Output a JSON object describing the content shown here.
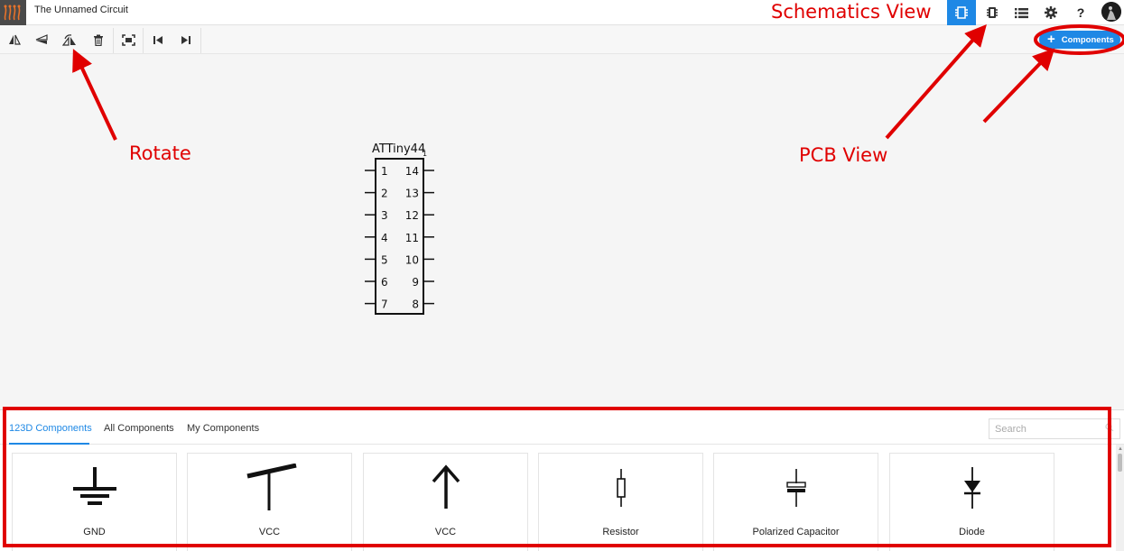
{
  "app": {
    "title": "The Unnamed Circuit"
  },
  "top_nav": {
    "schematic_view_icon": "schematic-chip-icon",
    "pcb_view_icon": "pcb-chip-icon",
    "list_icon": "list-icon",
    "settings_icon": "gear-icon",
    "help_label": "?"
  },
  "toolbar": {
    "tools": [
      "flip-horizontal-icon",
      "flip-vertical-icon",
      "rotate-icon",
      "trash-icon",
      "fit-to-screen-icon",
      "skip-back-icon",
      "skip-forward-icon"
    ],
    "components_button_label": "Components"
  },
  "schematic": {
    "part_name": "ATTiny44",
    "part_index": "1",
    "left_pins": [
      "1",
      "2",
      "3",
      "4",
      "5",
      "6",
      "7"
    ],
    "right_pins": [
      "14",
      "13",
      "12",
      "11",
      "10",
      "9",
      "8"
    ]
  },
  "annotations": {
    "schematics_view": "Schematics View",
    "rotate": "Rotate",
    "pcb_view": "PCB View"
  },
  "panel": {
    "tabs": [
      "123D Components",
      "All Components",
      "My Components"
    ],
    "active_tab": "123D Components",
    "search_placeholder": "Search",
    "cards": [
      {
        "label": "GND",
        "icon": "ground-symbol-icon"
      },
      {
        "label": "VCC",
        "icon": "vcc-bar-symbol-icon"
      },
      {
        "label": "VCC",
        "icon": "vcc-arrow-symbol-icon"
      },
      {
        "label": "Resistor",
        "icon": "resistor-symbol-icon"
      },
      {
        "label": "Polarized Capacitor",
        "icon": "polarized-capacitor-symbol-icon"
      },
      {
        "label": "Diode",
        "icon": "diode-symbol-icon"
      }
    ]
  },
  "colors": {
    "accent": "#1e88e5",
    "annotation": "#e00000"
  }
}
